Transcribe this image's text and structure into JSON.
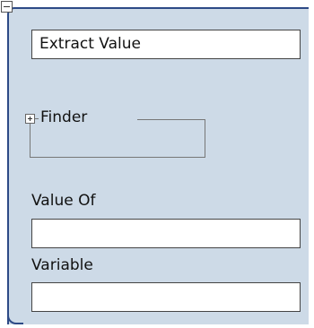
{
  "step": {
    "title_value": "Extract Value",
    "finder_label": "Finder",
    "fields": [
      {
        "label": "Value Of",
        "value": ""
      },
      {
        "label": "Variable",
        "value": ""
      }
    ]
  },
  "colors": {
    "panel_background": "#cddae7",
    "panel_border": "#2d4a86",
    "input_background": "#ffffff"
  },
  "icons": {
    "collapse": "collapse-minus-icon",
    "expand": "expand-plus-icon"
  }
}
